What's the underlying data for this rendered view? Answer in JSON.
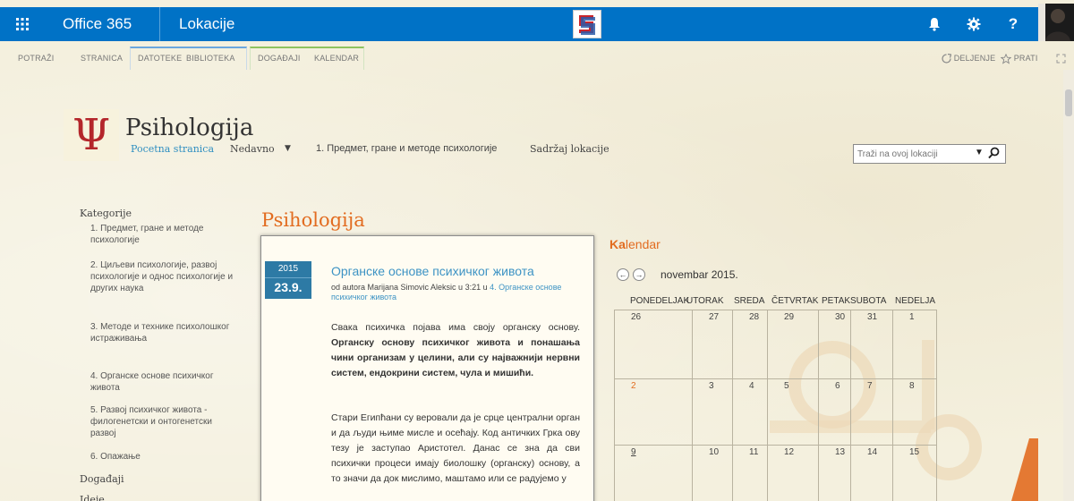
{
  "suitebar": {
    "app_name": "Office 365",
    "site_label": "Lokacije",
    "help_label": "?",
    "bg_color": "#0072c6"
  },
  "ribbon": {
    "tabs": [
      "POTRAŽI",
      "STRANICA",
      "DATOTEKE",
      "BIBLIOTEKA",
      "DOGAĐAJI",
      "KALENDAR"
    ],
    "share_label": "DELJENJE",
    "follow_label": "PRATI"
  },
  "header": {
    "logo_glyph": "Ψ",
    "title": "Psihologija",
    "nav": {
      "home": "Pocetna stranica",
      "recent": "Nedavno",
      "recent_arrow": "▼",
      "topic": "1. Предмет, гране и методе психологије",
      "contents": "Sadržaj lokacije"
    },
    "search_placeholder": "Traži na ovoj lokaciji"
  },
  "leftnav": {
    "categories_heading": "Kategorije",
    "items": [
      "1. Предмет, гране и методе психологије",
      "2. Циљеви психологије, развој психологије и однос психологије и других наука",
      "3. Методе и технике психолошког истраживања",
      "4. Органске основе психичког живота",
      "5. Развој психичког живота - филогенетски и онтогенетски развој",
      "6. Опажање"
    ],
    "events_heading": "Događaji",
    "ideas_heading": "Ideje"
  },
  "main": {
    "page_title": "Psihologija",
    "post": {
      "year": "2015",
      "date": "23.9.",
      "title": "Органске основе психичког живота",
      "meta_prefix": "od autora Marijana Simovic Aleksic u 3:21 u ",
      "meta_link": "4. Органске основе психичког живота",
      "para1_text": "Свака психичка појава има своју органску основу. ",
      "para1_bold": "Органску основу психичког живота и понашања чини организам у целини, али су најважнији нервни систем, ендокрини систем, чула и мишићи.",
      "para2": "Стари Египћани су веровали да је срце централни орган и да људи њиме мисле и осећају. Код античких Грка ову тезу је заступао Аристотел. Данас се зна да сви психички процеси имају биолошку (органску) основу, а то значи да док мислимо, маштамо или се радујемо у"
    }
  },
  "calendar": {
    "title_bold": "Ka",
    "title_rest": "lendar",
    "month_label": "novembar 2015.",
    "prev_symbol": "←",
    "next_symbol": "→",
    "weekdays": [
      "PONEDELJAK",
      "UTORAK",
      "SREDA",
      "ČETVRTAK",
      "PETAK",
      "SUBOTA",
      "NEDELJA"
    ],
    "weeks": [
      [
        "26",
        "27",
        "28",
        "29",
        "30",
        "31",
        "1"
      ],
      [
        "2",
        "3",
        "4",
        "5",
        "6",
        "7",
        "8"
      ],
      [
        "9",
        "10",
        "11",
        "12",
        "13",
        "14",
        "15"
      ]
    ],
    "today_color": "#e26c20"
  }
}
